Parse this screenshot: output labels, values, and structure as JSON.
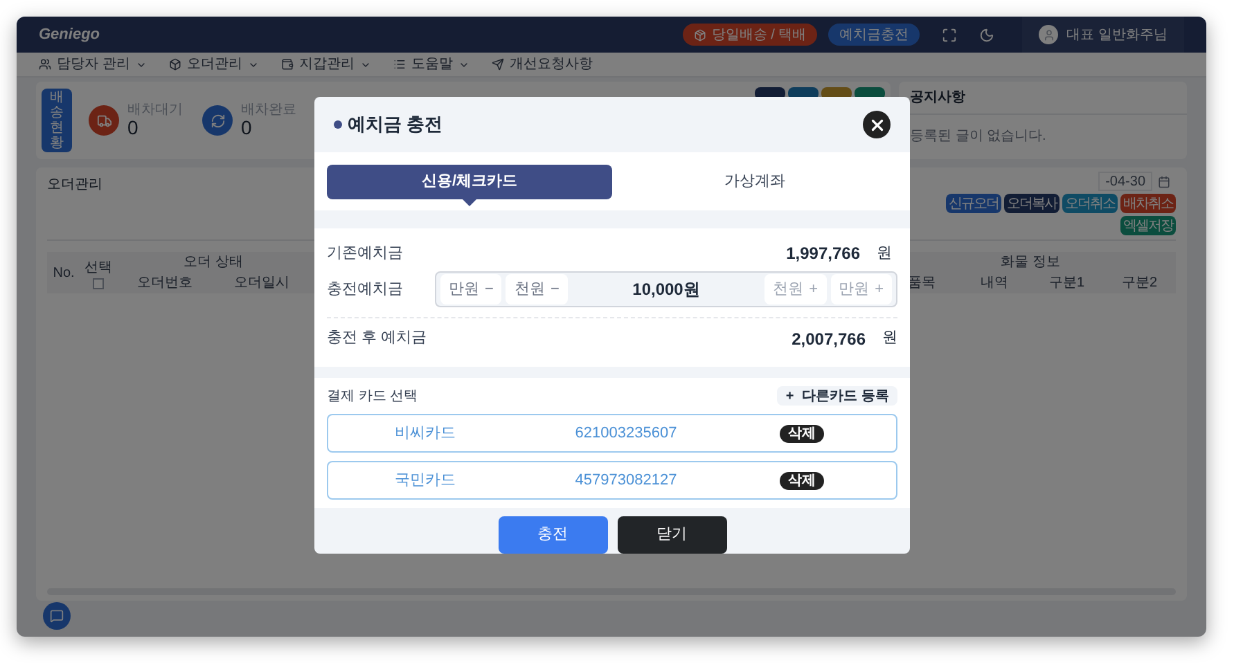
{
  "header": {
    "logo": "Geniego",
    "pills": [
      {
        "label": "당일배송 / 택배",
        "kind": "delivery"
      },
      {
        "label": "예치금충전",
        "kind": "charge"
      }
    ],
    "user": "대표 일반화주님"
  },
  "nav": [
    {
      "label": "담당자 관리",
      "dropdown": true
    },
    {
      "label": "오더관리",
      "dropdown": true
    },
    {
      "label": "지갑관리",
      "dropdown": true
    },
    {
      "label": "도움말",
      "dropdown": true
    },
    {
      "label": "개선요청사항",
      "dropdown": false
    }
  ],
  "stats": {
    "tile": "배송현황",
    "items": [
      {
        "label": "배차대기",
        "value": "0"
      },
      {
        "label": "배차완료",
        "value": "0"
      }
    ]
  },
  "notice": {
    "title": "공지사항",
    "empty": "등록된 글이 없습니다."
  },
  "orders": {
    "title": "오더관리",
    "date": "-04-30",
    "buttons": [
      "신규오더",
      "오더복사",
      "오더취소",
      "배차취소",
      "엑셀저장"
    ],
    "head_groups": [
      "No.",
      "선택",
      "오더 상태",
      "화물 정보"
    ],
    "status_columns": [
      "오더번호",
      "오더일시"
    ],
    "cargo_columns": [
      "품목",
      "내역",
      "구분1",
      "구분2"
    ],
    "select_all": false
  },
  "modal": {
    "title": "예치금 충전",
    "tabs": [
      {
        "label": "신용/체크카드",
        "selected": true
      },
      {
        "label": "가상계좌",
        "selected": false
      }
    ],
    "balance": {
      "label": "기존예치금",
      "value": "1,997,766",
      "unit": "원"
    },
    "charge": {
      "label": "충전예치금",
      "amount": "10,000원",
      "steps": [
        {
          "label": "만원",
          "sign": "−",
          "kind": "decrease"
        },
        {
          "label": "천원",
          "sign": "−",
          "kind": "decrease"
        },
        {
          "label": "천원",
          "sign": "+",
          "kind": "increase"
        },
        {
          "label": "만원",
          "sign": "+",
          "kind": "increase"
        }
      ]
    },
    "after": {
      "label": "충전 후 예치금",
      "value": "2,007,766",
      "unit": "원"
    },
    "cards": {
      "label": "결제 카드 선택",
      "add_sign": "+",
      "add_label": "다른카드 등록",
      "items": [
        {
          "name": "비씨카드",
          "number": "621003235607",
          "delete": "삭제"
        },
        {
          "name": "국민카드",
          "number": "457973082127",
          "delete": "삭제"
        }
      ]
    },
    "buttons": [
      {
        "label": "충전",
        "kind": "primary"
      },
      {
        "label": "닫기",
        "kind": "dark"
      }
    ]
  }
}
